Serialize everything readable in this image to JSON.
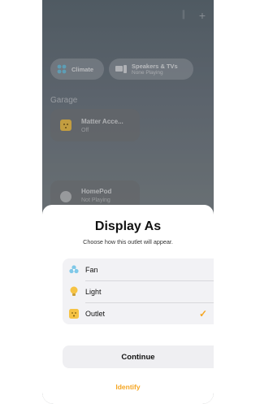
{
  "background": {
    "chips": [
      {
        "label": "Climate",
        "sub": ""
      },
      {
        "label": "Speakers & TVs",
        "sub": "None Playing"
      }
    ],
    "section": "Garage",
    "tiles": [
      {
        "title": "Matter Acce...",
        "sub": "Off"
      },
      {
        "title": "HomePod",
        "sub": "Not Playing"
      }
    ]
  },
  "sheet": {
    "title": "Display As",
    "subtitle": "Choose how this outlet will appear.",
    "options": [
      {
        "label": "Fan",
        "icon": "fan-icon",
        "color": "#7fc8e8"
      },
      {
        "label": "Light",
        "icon": "lightbulb-icon",
        "color": "#f6c344"
      },
      {
        "label": "Outlet",
        "icon": "outlet-icon",
        "color": "#f6c344",
        "selected": true
      }
    ],
    "continue_label": "Continue",
    "identify_label": "Identify",
    "accent": "#f5a623"
  }
}
